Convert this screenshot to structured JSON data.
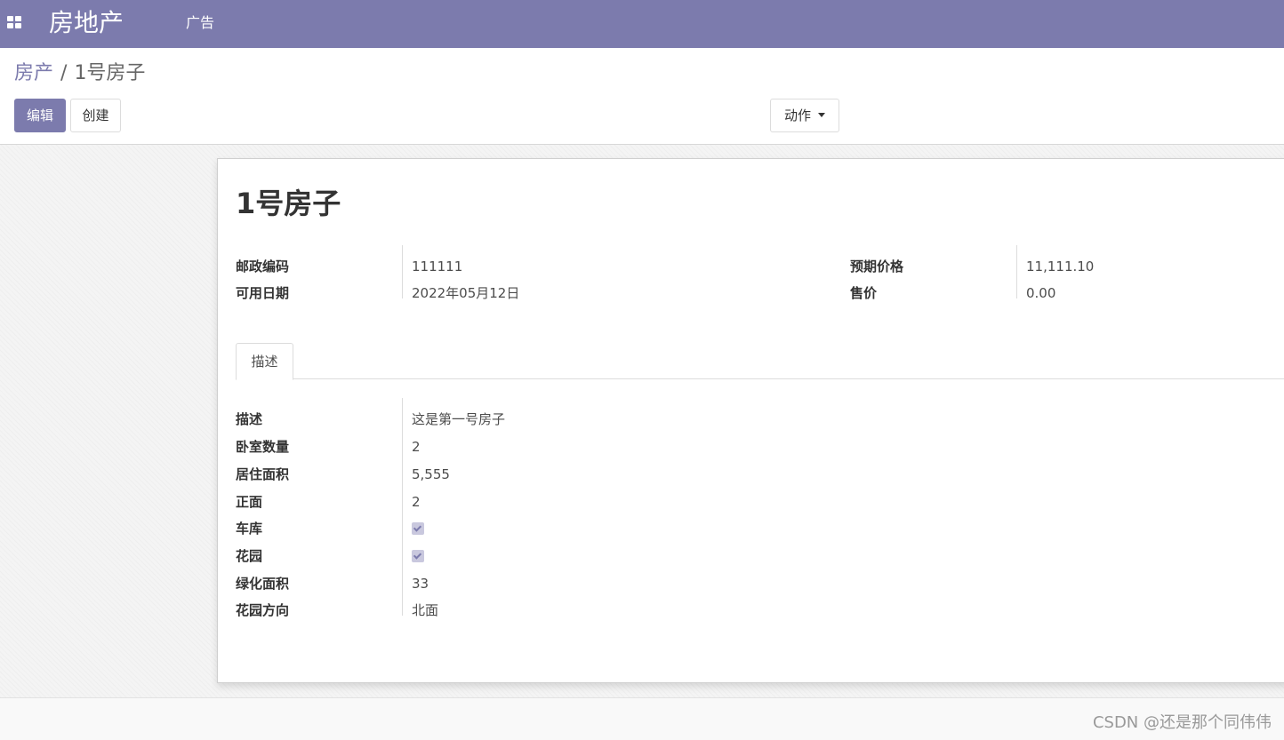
{
  "navbar": {
    "brand": "房地产",
    "menu_items": [
      {
        "label": "广告"
      }
    ]
  },
  "breadcrumb": {
    "parent": "房产",
    "separator": "/",
    "current": "1号房子"
  },
  "toolbar": {
    "edit_label": "编辑",
    "create_label": "创建",
    "action_label": "动作"
  },
  "record": {
    "title": "1号房子",
    "left_fields": [
      {
        "label": "邮政编码",
        "value": "111111"
      },
      {
        "label": "可用日期",
        "value": "2022年05月12日"
      }
    ],
    "right_fields": [
      {
        "label": "预期价格",
        "value": "11,111.10"
      },
      {
        "label": "售价",
        "value": "0.00"
      }
    ]
  },
  "tabs": [
    {
      "label": "描述",
      "active": true
    }
  ],
  "description_fields": [
    {
      "label": "描述",
      "value": "这是第一号房子"
    },
    {
      "label": "卧室数量",
      "value": "2"
    },
    {
      "label": "居住面积",
      "value": "5,555"
    },
    {
      "label": "正面",
      "value": "2"
    },
    {
      "label": "车库",
      "checked": true
    },
    {
      "label": "花园",
      "checked": true
    },
    {
      "label": "绿化面积",
      "value": "33"
    },
    {
      "label": "花园方向",
      "value": "北面"
    }
  ],
  "watermark": "CSDN @还是那个同伟伟",
  "colors": {
    "brand": "#7c7bad",
    "text": "#4c4c4c",
    "border": "#dcdcdc"
  }
}
